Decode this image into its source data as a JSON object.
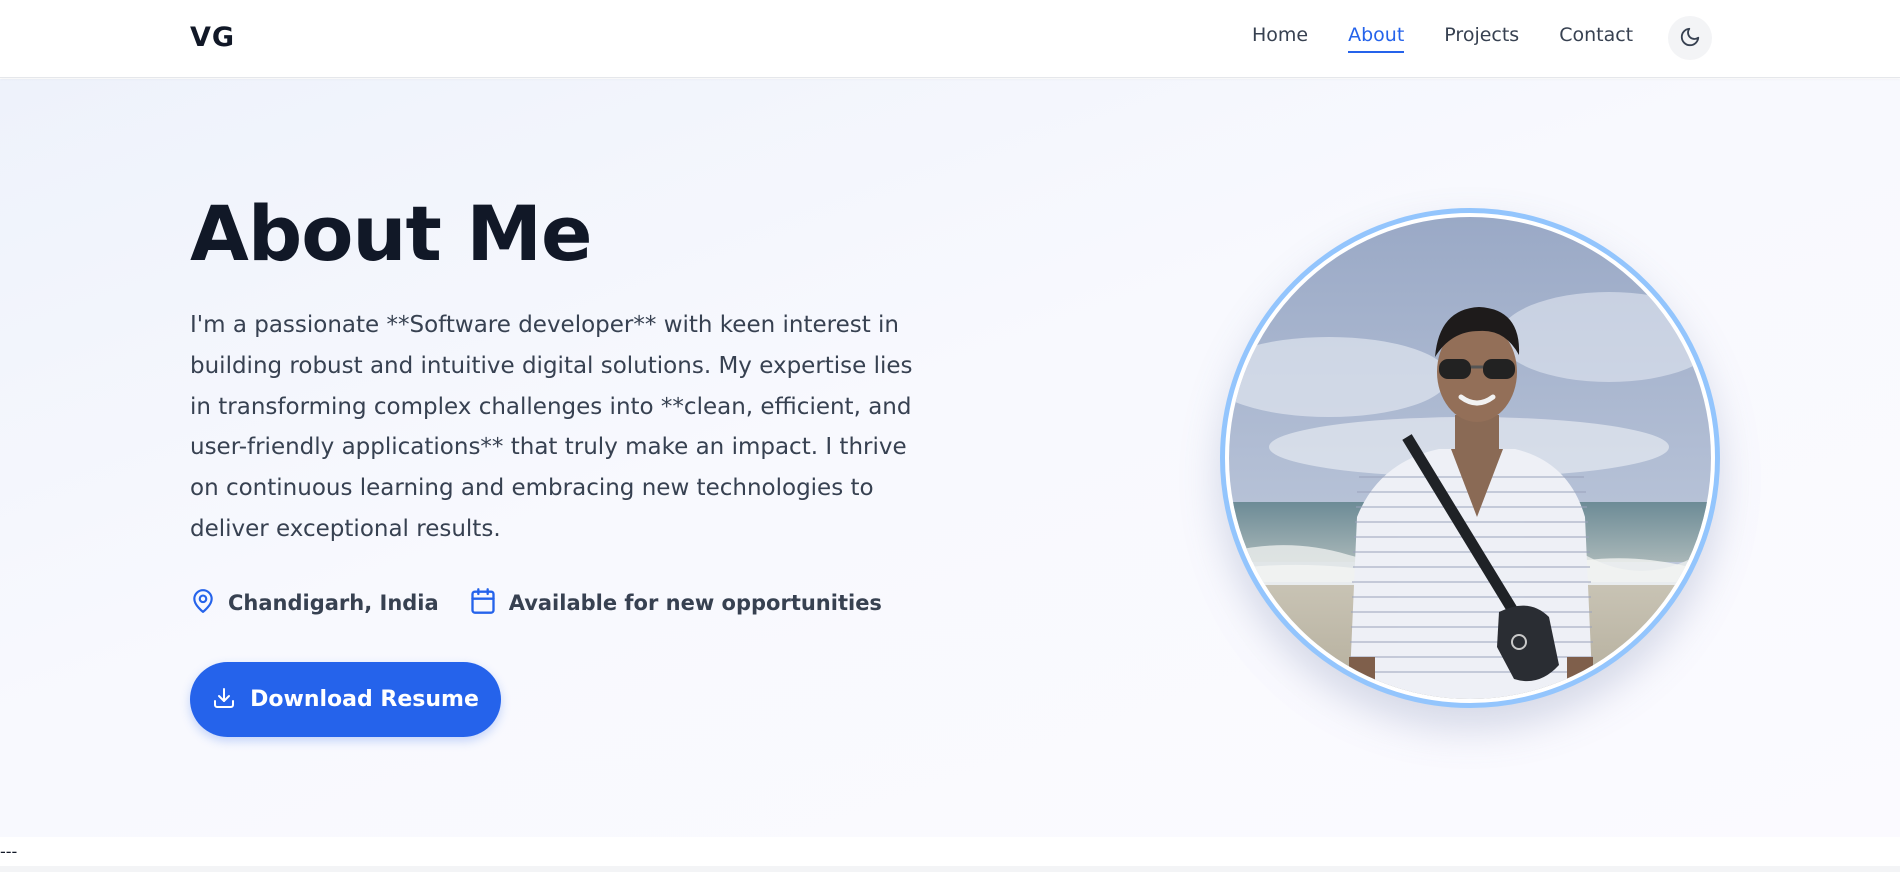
{
  "header": {
    "logo": "VG",
    "nav": [
      {
        "label": "Home",
        "active": false
      },
      {
        "label": "About",
        "active": true
      },
      {
        "label": "Projects",
        "active": false
      },
      {
        "label": "Contact",
        "active": false
      }
    ],
    "theme_toggle_icon": "moon-icon"
  },
  "hero": {
    "title": "About Me",
    "bio": "I'm a passionate **Software developer** with keen interest in building robust and intuitive digital solutions. My expertise lies in transforming complex challenges into **clean, efficient, and user-friendly applications** that truly make an impact. I thrive on continuous learning and embracing new technologies to deliver exceptional results.",
    "location": "Chandigarh, India",
    "availability": "Available for new opportunities",
    "location_icon": "map-pin-icon",
    "availability_icon": "calendar-icon",
    "download_label": "Download Resume",
    "download_icon": "download-icon"
  },
  "footer": {
    "divider": "---"
  },
  "colors": {
    "accent": "#2563eb",
    "ring": "#93c5fd",
    "text_dark": "#111827",
    "text_body": "#374151"
  }
}
